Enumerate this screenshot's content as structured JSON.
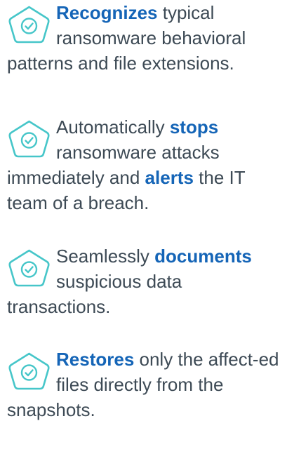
{
  "colors": {
    "accent": "#1565b7",
    "text": "#3d4a55",
    "icon": "#46c6c9"
  },
  "features": [
    {
      "icon": "check-badge-icon",
      "bold": "Recognizes",
      "text": " typical ransomware behavioral patterns and file extensions."
    },
    {
      "icon": "check-badge-icon",
      "lead": " Automatically ",
      "bold": "stops",
      "middle": " ransomware attacks immediately and ",
      "bold2": "alerts",
      "text": " the IT team of a breach."
    },
    {
      "icon": "check-badge-icon",
      "lead": " Seamlessly ",
      "bold": "documents",
      "text": " suspicious data transactions."
    },
    {
      "icon": "check-badge-icon",
      "bold": "Restores",
      "text": " only the affect-ed files directly from the snapshots."
    }
  ]
}
